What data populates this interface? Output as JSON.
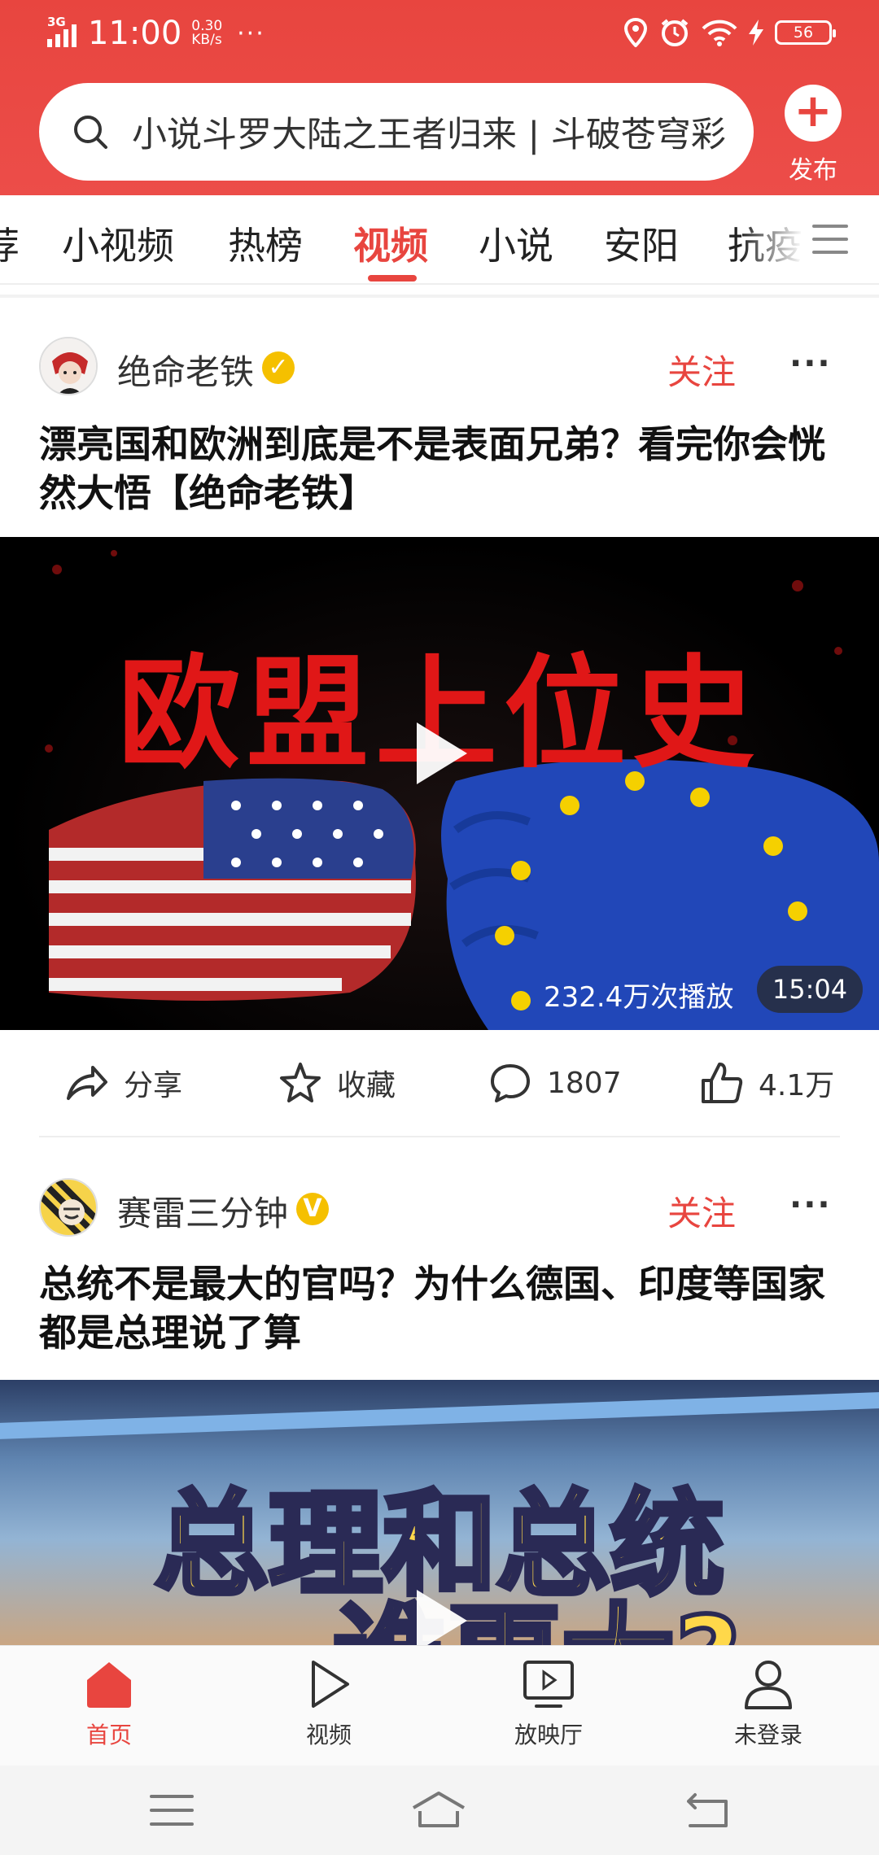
{
  "status_bar": {
    "network": "3G",
    "time": "11:00",
    "speed_value": "0.30",
    "speed_unit": "KB/s",
    "more": "···",
    "battery": "56"
  },
  "search": {
    "text": "小说斗罗大陆之王者归来 | 斗破苍穹彩"
  },
  "publish": {
    "label": "发布"
  },
  "tabs": [
    {
      "label": "荐"
    },
    {
      "label": "小视频"
    },
    {
      "label": "热榜"
    },
    {
      "label": "视频",
      "active": true
    },
    {
      "label": "小说"
    },
    {
      "label": "安阳"
    },
    {
      "label": "抗疫"
    }
  ],
  "cards": [
    {
      "author": "绝命老铁",
      "follow_label": "关注",
      "more": "···",
      "title": "漂亮国和欧洲到底是不是表面兄弟？看完你会恍然大悟【绝命老铁】",
      "thumbnail_text": "欧盟上位史",
      "views": "232.4万次播放",
      "duration": "15:04",
      "actions": {
        "share": "分享",
        "favorite": "收藏",
        "comments": "1807",
        "likes": "4.1万"
      }
    },
    {
      "author": "赛雷三分钟",
      "follow_label": "关注",
      "more": "···",
      "title": "总统不是最大的官吗？为什么德国、印度等国家都是总理说了算",
      "thumbnail_text": "总理和总统",
      "thumbnail_text_2": "谁更大?"
    }
  ],
  "bottom_nav": [
    {
      "label": "首页",
      "icon": "home-icon",
      "active": true
    },
    {
      "label": "视频",
      "icon": "video-play-icon"
    },
    {
      "label": "放映厅",
      "icon": "screening-room-icon"
    },
    {
      "label": "未登录",
      "icon": "user-icon"
    }
  ],
  "colors": {
    "accent": "#e8453f",
    "verified": "#f5c000"
  }
}
